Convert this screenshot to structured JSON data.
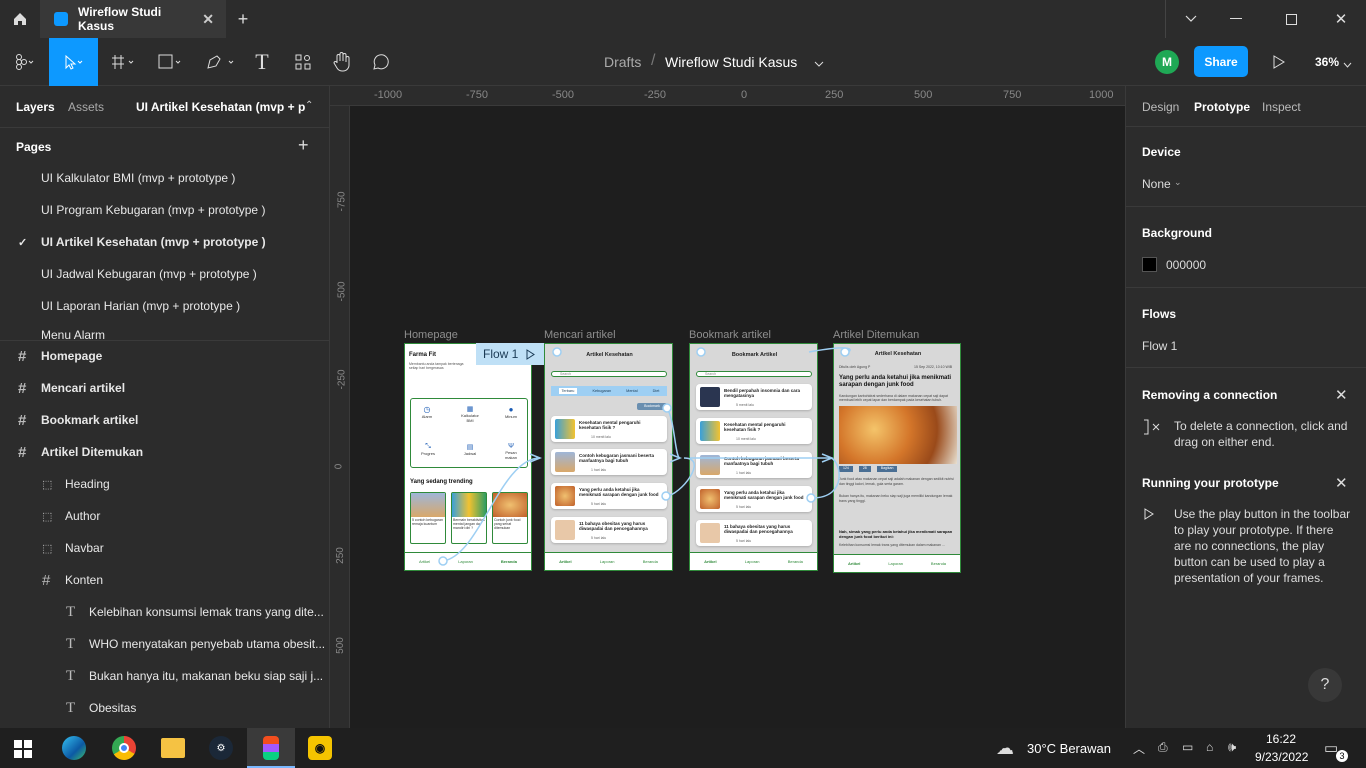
{
  "window": {
    "tab_title": "Wireflow Studi Kasus"
  },
  "toolbar": {
    "breadcrumb_root": "Drafts",
    "file_name": "Wireflow Studi Kasus",
    "avatar": "M",
    "share": "Share",
    "zoom": "36%"
  },
  "left": {
    "tab_layers": "Layers",
    "tab_assets": "Assets",
    "page_selector": "UI Artikel Kesehatan (mvp + p...",
    "pages_label": "Pages",
    "pages": [
      "UI Kalkulator BMI (mvp + prototype )",
      "UI Program Kebugaran (mvp + prototype )",
      "UI Artikel Kesehatan (mvp + prototype )",
      "UI Jadwal Kebugaran (mvp + prototype )",
      "UI Laporan Harian (mvp + prototype )",
      "Menu Alarm"
    ],
    "layers": [
      "Homepage",
      "Mencari artikel",
      "Bookmark artikel",
      "Artikel Ditemukan",
      "Heading",
      "Author",
      "Navbar",
      "Konten",
      "Kelebihan konsumsi lemak trans yang dite...",
      "WHO menyatakan penyebab utama obesit...",
      "Bukan hanya itu, makanan beku siap saji j...",
      "Obesitas"
    ]
  },
  "ruler": {
    "x": [
      "-1000",
      "-750",
      "-500",
      "-250",
      "0",
      "250",
      "500",
      "750",
      "1000"
    ],
    "y": [
      "-750",
      "-500",
      "-250",
      "0",
      "250",
      "500"
    ]
  },
  "frames": {
    "home": {
      "label": "Homepage",
      "app": "Farma Fit",
      "tagline": "Membantu anda tampak bertenaga setiap hari bergerasas",
      "grid": [
        "Alarm",
        "Kalkulator BMI",
        "Minum",
        "Progres",
        "Jadwal",
        "Pesan makan"
      ],
      "trending": "Yang sedang trending",
      "cards": [
        "5 contoh kebugaran remaja kuantum",
        "Bermain beraktivitas mental jangan da mandiri diri ?",
        "Contoh junk food yang sehat ditemukan"
      ],
      "nav": [
        "Artikel",
        "Laporan",
        "Beranda"
      ]
    },
    "search": {
      "label": "Mencari artikel",
      "header": "Artikel Kesehatan",
      "search_ph": "Search",
      "chips": [
        "Terbaru",
        "Kebugaran",
        "Mental",
        "Diet"
      ],
      "bookmark_chip": "Bookmark",
      "items": [
        "Kesehatan mental pengaruhi kesehatan fisik ?",
        "Contoh kebugaran jasmani beserta manfaatnya bagi tubuh",
        "Yang perlu anda ketahui jika menikmati sarapan dengan junk food",
        "11 bahaya obesitas yang harus diwaspadai dan pencegahannya"
      ],
      "times": [
        "10 menit lalu",
        "1 hari lalu",
        "5 hari lalu",
        "5 hari lalu"
      ],
      "nav": [
        "Artikel",
        "Laporan",
        "Beranda"
      ]
    },
    "bookmark": {
      "label": "Bookmark artikel",
      "header": "Bookmark Artikel",
      "search_ph": "Search",
      "items": [
        "Bendil perpahah insomnia dan cara mengatasinya",
        "Kesehatan mental pengaruhi kesehatan fisik ?",
        "Contoh kebugaran jasmani beserta manfaatnya bagi tubuh",
        "Yang perlu anda ketahui jika menikmati sarapan dengan junk food",
        "11 bahaya obesitas yang harus diwaspadai dan pencegahannya"
      ],
      "times": [
        "5 menit lalu",
        "10 menit lalu",
        "1 hari lalu",
        "5 hari lalu",
        "5 hari lalu"
      ],
      "nav": [
        "Artikel",
        "Laporan",
        "Beranda"
      ]
    },
    "article": {
      "label": "Artikel Ditemukan",
      "header": "Artikel Kesehatan",
      "author": "Ditulis oleh Agung P",
      "date": "15 Sep 2022, 10:10 WIB",
      "title": "Yang perlu anda ketahui jika menikmati sarapan dengan junk food",
      "intro": "Kandungan karbohidrat sederhana di dalam makanan cepat saji dapat membuat lebih cepat lapar dan berdampak pada kesehatan tubuh.",
      "stats": [
        "124",
        "28",
        "Bagikan"
      ],
      "p1": "Junk food atau makanan cepat saji adalah makanan dengan sedikit nutrisi dan tinggi kalori, lemak, gula serta garam.",
      "p2": "Bukan hanya itu, makanan beku siap saji juga memiliki kandungan lemak trans yang tinggi.",
      "bold": "Nah, simak yang perlu anda ketahui jika menikmati sarapan dengan junk food berikut ini:",
      "p3": "Kelebihan konsumsi lemak trans yang ditemukan dalam makanan ...",
      "nav": [
        "Artikel",
        "Laporan",
        "Beranda"
      ]
    },
    "flow_label": "Flow 1"
  },
  "right": {
    "tabs": [
      "Design",
      "Prototype",
      "Inspect"
    ],
    "device_label": "Device",
    "device_value": "None",
    "bg_label": "Background",
    "bg_value": "000000",
    "flows_label": "Flows",
    "flow1": "Flow 1",
    "remove_title": "Removing a connection",
    "remove_text": "To delete a connection, click and drag on either end.",
    "run_title": "Running your prototype",
    "run_text": "Use the play button in the toolbar to play your prototype. If there are no connections, the play button can be used to play a presentation of your frames.",
    "help": "?"
  },
  "taskbar": {
    "weather": "30°C  Berawan",
    "time": "16:22",
    "date": "9/23/2022",
    "notif": "3"
  },
  "colors": {
    "accent": "#0d99ff",
    "green": "#2f8a3a",
    "flow": "#9ecff3"
  }
}
